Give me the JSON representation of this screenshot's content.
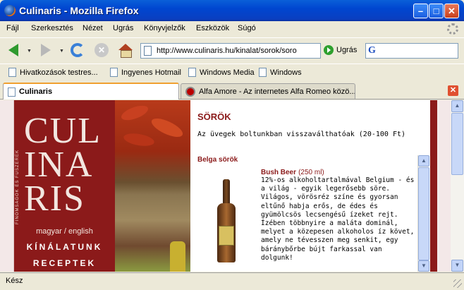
{
  "window": {
    "title": "Culinaris - Mozilla Firefox"
  },
  "menu": [
    "Fájl",
    "Szerkesztés",
    "Nézet",
    "Ugrás",
    "Könyvjelzők",
    "Eszközök",
    "Súgó"
  ],
  "navbar": {
    "url": "http://www.culinaris.hu/kinalat/sorok/soro",
    "go_label": "Ugrás",
    "search_value": ""
  },
  "bookmarks": [
    "Hivatkozások testres...",
    "Ingyenes Hotmail",
    "Windows Media",
    "Windows"
  ],
  "tabs": [
    {
      "label": "Culinaris",
      "active": true
    },
    {
      "label": "Alfa Amore - Az internetes Alfa Romeo közö...",
      "active": false
    }
  ],
  "page": {
    "logo": {
      "brand_lines": [
        "CUL",
        "INA",
        "RIS"
      ],
      "tagline": "FINOMSÁGOK ÉS FŰSZEREK",
      "language": "magyar / english",
      "menu_items": [
        "KÍNÁLATUNK",
        "RECEPTEK"
      ]
    },
    "heading": "SÖRÖK",
    "note": "Az üvegek boltunkban visszaválthatóak (20-100 Ft)",
    "section_title": "Belga sörök",
    "product": {
      "name": "Bush Beer",
      "volume": "(250 ml)",
      "description": "12%-os alkoholtartalmával Belgium - és a világ - egyik legerősebb söre. Világos, vörösréz színe és gyorsan eltűnő habja erős, de édes és gyümölcsös lecsengésű ízeket rejt. Ízében többnyire a maláta dominál, melyet a közepesen alkoholos íz követ, amely ne tévesszen meg senkit, egy báránybőrbe bújt farkassal van dolgunk!"
    }
  },
  "status": "Kész"
}
